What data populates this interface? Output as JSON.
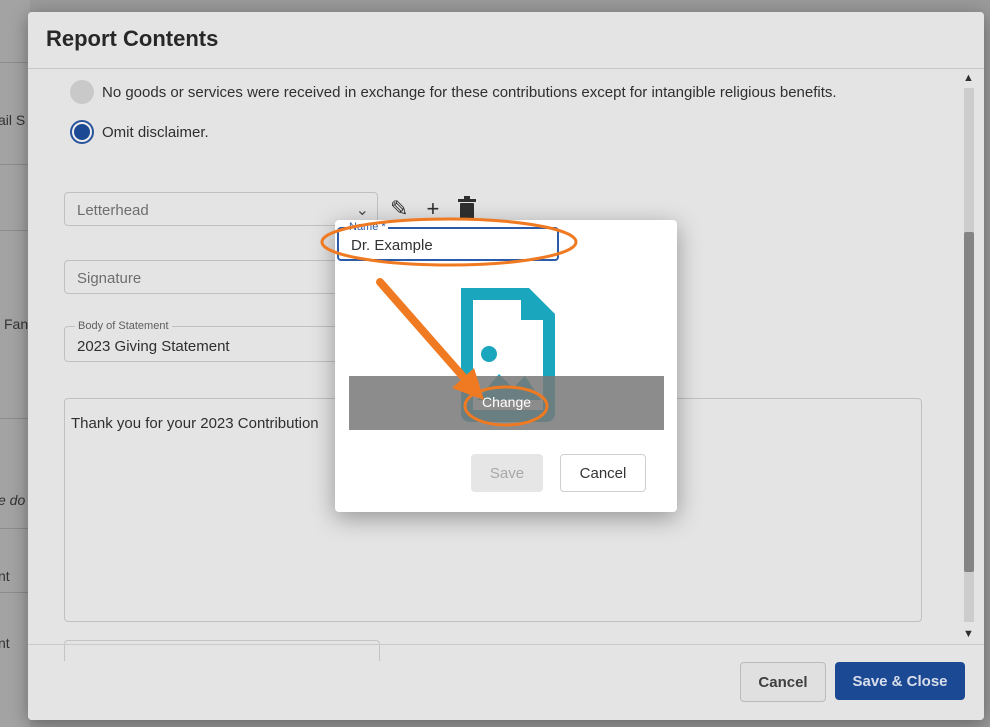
{
  "background": {
    "fragments": [
      "ail S",
      "Fan",
      "e do",
      "nt",
      "nt"
    ]
  },
  "dialog": {
    "title": "Report Contents",
    "radio_options": [
      {
        "label": "No goods or services were received in exchange for these contributions except for intangible religious benefits.",
        "selected": false
      },
      {
        "label": "Omit disclaimer.",
        "selected": true
      }
    ],
    "letterhead_field": {
      "placeholder": "Letterhead"
    },
    "signature_field": {
      "placeholder": "Signature"
    },
    "body_field": {
      "label": "Body of Statement",
      "value": "2023 Giving Statement"
    },
    "statement_text": "Thank you for your 2023 Contribution",
    "tool_icons": [
      "pencil-icon",
      "plus-icon",
      "trash-icon"
    ],
    "footer": {
      "cancel_label": "Cancel",
      "save_close_label": "Save & Close"
    }
  },
  "modal": {
    "name_label": "Name *",
    "name_value": "Dr. Example",
    "change_label": "Change",
    "save_label": "Save",
    "cancel_label": "Cancel"
  },
  "colors": {
    "primary": "#1f4fa0",
    "accent_icon": "#1aa6bd",
    "annotation": "#f07a22"
  }
}
